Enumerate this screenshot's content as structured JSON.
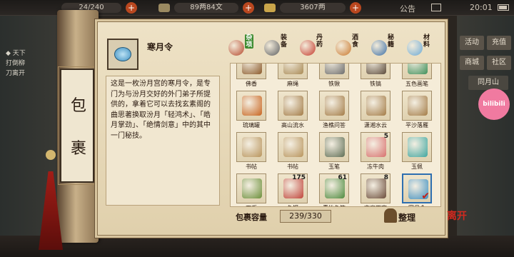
{
  "hud": {
    "resources": [
      {
        "label": "体力",
        "value": "24/240"
      },
      {
        "label": "铜钱",
        "value": "89两84文"
      },
      {
        "label": "银两",
        "value": "3607两"
      }
    ],
    "notice": "公告",
    "time": "20:01"
  },
  "world": {
    "chat_lines": [
      "◆ 天下",
      "打倒柳",
      "刀离开"
    ],
    "right_tabs": [
      "活动",
      "充值",
      "商城",
      "社区",
      "同月山"
    ],
    "bilibili": "bilibili"
  },
  "scroll": {
    "label_top": "包",
    "label_bottom": "裹"
  },
  "selected_item": {
    "name": "寒月令",
    "icon": "jade-token-icon",
    "description": "这是一枚汾月宫的寒月令，是专门为与汾月交好的外门弟子所提供的，拿着它可以去找玄素阁的曲思著换取汾月「轻鸿术」、「皓月掌劲」、「绝情剑意」中的其中一门秘技。"
  },
  "tabs": [
    {
      "label": "杂项",
      "icon": "bag-icon",
      "color": "#b5462a",
      "active": true
    },
    {
      "label": "装备",
      "icon": "armor-icon",
      "color": "#5b5d60",
      "active": false
    },
    {
      "label": "丹药",
      "icon": "pill-icon",
      "color": "#c4382b",
      "active": false
    },
    {
      "label": "酒食",
      "icon": "jar-icon",
      "color": "#c9772c",
      "active": false
    },
    {
      "label": "秘籍",
      "icon": "book-icon",
      "color": "#3b6ea5",
      "active": false
    },
    {
      "label": "材料",
      "icon": "gem-icon",
      "color": "#6aa9d6",
      "active": false
    }
  ],
  "items": [
    {
      "name": "佛香",
      "icon": "incense-icon",
      "color": "#8b5a2b",
      "qty": ""
    },
    {
      "name": "麻绳",
      "icon": "rope-icon",
      "color": "#a98a55",
      "qty": ""
    },
    {
      "name": "铁锹",
      "icon": "shovel-icon",
      "color": "#6d6d6d",
      "qty": ""
    },
    {
      "name": "铁镐",
      "icon": "pickaxe-icon",
      "color": "#5b4a3a",
      "qty": ""
    },
    {
      "name": "五色画笔",
      "icon": "brush-icon",
      "color": "#3d8f5a",
      "qty": ""
    },
    {
      "name": "琉璃罐",
      "icon": "jar-icon",
      "color": "#c8641f",
      "qty": ""
    },
    {
      "name": "高山流水",
      "icon": "score-icon",
      "color": "#a37b46",
      "qty": ""
    },
    {
      "name": "渔樵问答",
      "icon": "score-icon",
      "color": "#a37b46",
      "qty": ""
    },
    {
      "name": "潇湘水云",
      "icon": "score-icon",
      "color": "#a37b46",
      "qty": ""
    },
    {
      "name": "平沙落雁",
      "icon": "score-icon",
      "color": "#a37b46",
      "qty": ""
    },
    {
      "name": "书帖",
      "icon": "scroll-icon",
      "color": "#b8945c",
      "qty": ""
    },
    {
      "name": "书帖",
      "icon": "scroll-icon",
      "color": "#b8945c",
      "qty": ""
    },
    {
      "name": "玉笔",
      "icon": "pen-icon",
      "color": "#5f6e55",
      "qty": ""
    },
    {
      "name": "冻牛肉",
      "icon": "meat-icon",
      "color": "#d8706e",
      "qty": "5"
    },
    {
      "name": "玉佩",
      "icon": "pendant-icon",
      "color": "#3fa6a0",
      "qty": ""
    },
    {
      "name": "刀币",
      "icon": "coin-icon",
      "color": "#6b8f3a",
      "qty": ""
    },
    {
      "name": "鱼饵",
      "icon": "worm-icon",
      "color": "#c0443a",
      "qty": "175"
    },
    {
      "name": "青竹鱼竿",
      "icon": "rod-icon",
      "color": "#4d8a3e",
      "qty": "61"
    },
    {
      "name": "文房四宝",
      "icon": "ink-icon",
      "color": "#6b4c3a",
      "qty": "8"
    },
    {
      "name": "寒月令",
      "icon": "jade-token-icon",
      "color": "#3e8fc1",
      "qty": "",
      "selected": true
    }
  ],
  "capacity": {
    "label": "包裹容量",
    "value": "239/330"
  },
  "sort_label": "整理",
  "close_label": "离开"
}
